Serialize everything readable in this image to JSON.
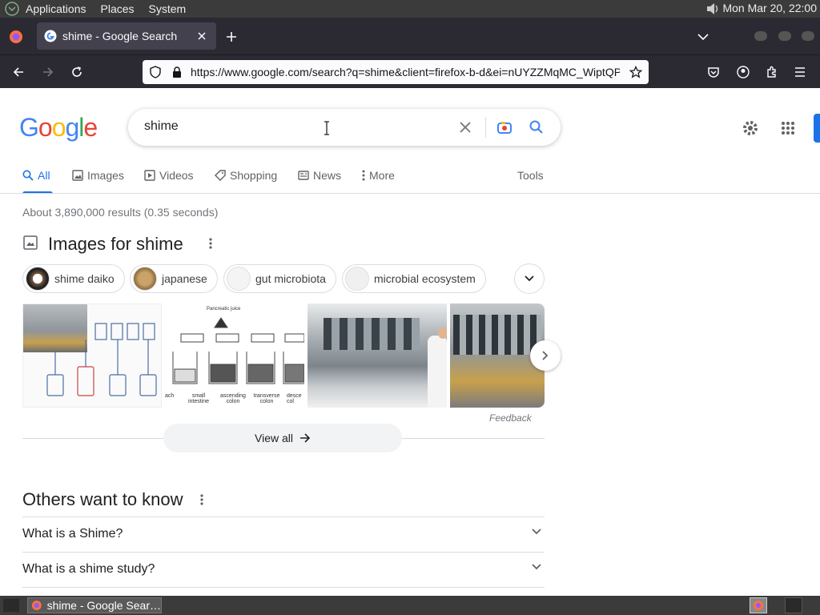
{
  "system_panel": {
    "menus": [
      "Applications",
      "Places",
      "System"
    ],
    "clock": "Mon Mar 20, 22:00"
  },
  "browser": {
    "tab_title": "shime - Google Search",
    "url_display": "https://www.google.com/search?q=shime&client=firefox-b-d&ei=nUYZZMqMC_WiptQP"
  },
  "search": {
    "query": "shime"
  },
  "tabs": [
    {
      "label": "All"
    },
    {
      "label": "Images"
    },
    {
      "label": "Videos"
    },
    {
      "label": "Shopping"
    },
    {
      "label": "News"
    },
    {
      "label": "More"
    }
  ],
  "tools_label": "Tools",
  "result_stats": "About 3,890,000 results (0.35 seconds)",
  "images_section": {
    "title": "Images for shime",
    "chips": [
      "shime daiko",
      "japanese",
      "gut microbiota",
      "microbial ecosystem"
    ],
    "diagram_labels": [
      "ach",
      "small intestine",
      "ascending colon",
      "transverse colon",
      "desce col"
    ],
    "diagram_top_label": "Pancreatic juice",
    "feedback": "Feedback",
    "view_all": "View all"
  },
  "others_section": {
    "title": "Others want to know",
    "questions": [
      "What is a Shime?",
      "What is a shime study?"
    ]
  },
  "taskbar": {
    "item_label": "shime - Google Sear…"
  },
  "colors": {
    "google_blue": "#4285F4",
    "google_red": "#EA4335",
    "google_yellow": "#FBBC05",
    "google_green": "#34A853",
    "link_blue": "#1a73e8"
  }
}
